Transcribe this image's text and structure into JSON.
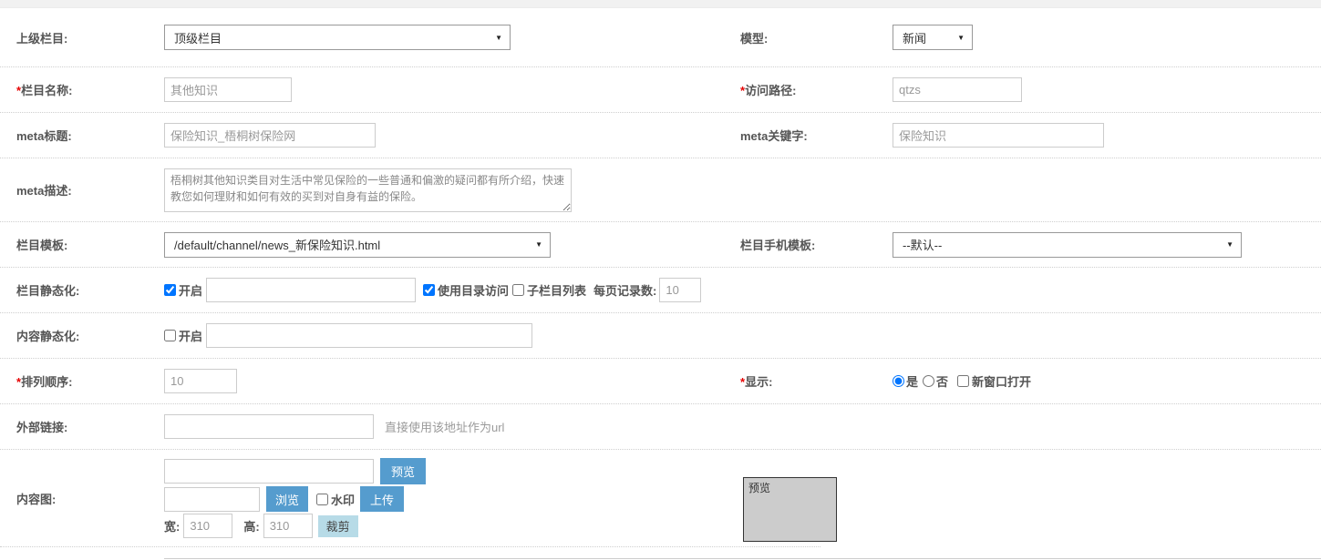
{
  "colors": {
    "button_blue": "#559cce",
    "button_light_blue": "#b7dbe7",
    "required_star": "#e60000",
    "preview_box_fill": "#cccccc"
  },
  "icons": {
    "dropdown_arrow": "▼"
  },
  "form": {
    "parent_category": {
      "label": "上级栏目:",
      "value": "顶级栏目"
    },
    "model": {
      "label": "模型:",
      "value": "新闻"
    },
    "category_name": {
      "star": "*",
      "label": "栏目名称:",
      "value": "其他知识"
    },
    "access_path": {
      "star": "*",
      "label": "访问路径:",
      "value": "qtzs"
    },
    "meta_title": {
      "label": "meta标题:",
      "value": "保险知识_梧桐树保险网"
    },
    "meta_keywords": {
      "label": "meta关键字:",
      "value": "保险知识"
    },
    "meta_description": {
      "label": "meta描述:",
      "value": "梧桐树其他知识类目对生活中常见保险的一些普通和偏激的疑问都有所介绍，快速教您如何理财和如何有效的买到对自身有益的保险。"
    },
    "category_template": {
      "label": "栏目模板:",
      "value": "/default/channel/news_新保险知识.html"
    },
    "category_mobile_template": {
      "label": "栏目手机模板:",
      "value": "--默认--"
    },
    "category_static": {
      "label": "栏目静态化:",
      "enable_label": "开启",
      "enable_checked": true,
      "path_value": "",
      "dir_label": "使用目录访问",
      "dir_checked": true,
      "sub_label": "子栏目列表",
      "sub_checked": false,
      "pagesize_label": "每页记录数:",
      "pagesize_value": "10"
    },
    "content_static": {
      "label": "内容静态化:",
      "enable_label": "开启",
      "enable_checked": false,
      "path_value": ""
    },
    "sort_order": {
      "star": "*",
      "label": "排列顺序:",
      "value": "10"
    },
    "display": {
      "star": "*",
      "label": "显示:",
      "yes_label": "是",
      "yes_checked": true,
      "no_label": "否",
      "no_checked": false,
      "newwin_label": "新窗口打开",
      "newwin_checked": false
    },
    "external_link": {
      "label": "外部链接:",
      "value": "",
      "hint": "直接使用该地址作为url"
    },
    "content_image": {
      "label": "内容图:",
      "image_url_value": "",
      "preview_btn": "预览",
      "file_value": "",
      "browse_btn": "浏览",
      "watermark_label": "水印",
      "watermark_checked": false,
      "upload_btn": "上传",
      "width_label": "宽:",
      "width_value": "310",
      "height_label": "高:",
      "height_value": "310",
      "crop_btn": "裁剪",
      "preview_box_label": "预览"
    }
  }
}
